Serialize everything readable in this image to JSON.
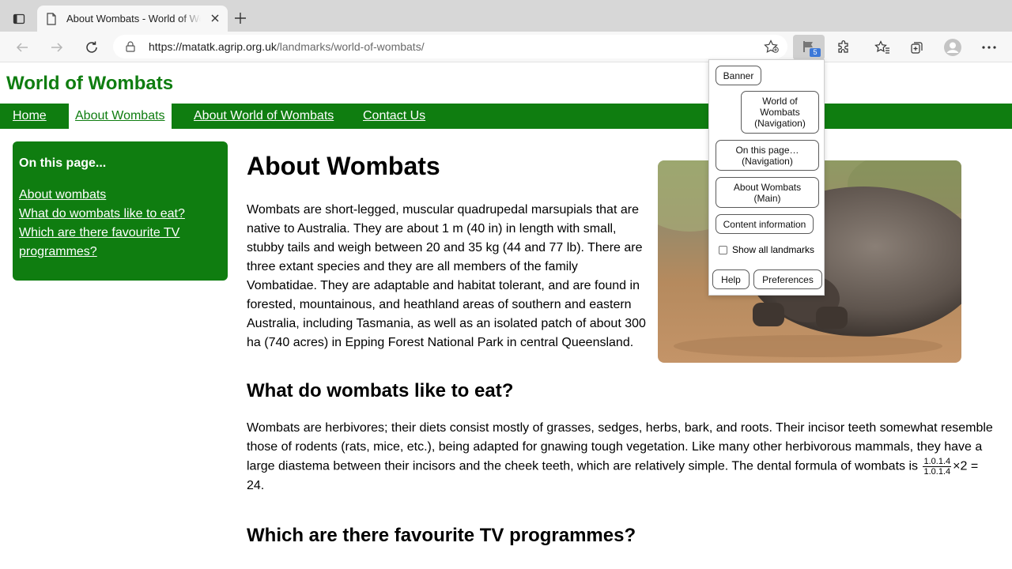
{
  "browser": {
    "tab_title": "About Wombats - World of Wombats",
    "url_host": "https://matatk.agrip.org.uk",
    "url_path": "/landmarks/world-of-wombats/",
    "extension_badge": "5"
  },
  "site": {
    "title": "World of Wombats",
    "nav": [
      "Home",
      "About Wombats",
      "About World of Wombats",
      "Contact Us"
    ],
    "brand_color": "#0f7d10"
  },
  "sidebar": {
    "title": "On this page...",
    "links": [
      "About wombats",
      "What do wombats like to eat?",
      "Which are there favourite TV programmes?"
    ]
  },
  "main": {
    "heading": "About Wombats",
    "intro": "Wombats are short-legged, muscular quadrupedal marsupials that are native to Australia. They are about 1 m (40 in) in length with small, stubby tails and weigh between 20 and 35 kg (44 and 77 lb). There are three extant species and they are all members of the family Vombatidae. They are adaptable and habitat tolerant, and are found in forested, mountainous, and heathland areas of southern and eastern Australia, including Tasmania, as well as an isolated patch of about 300 ha (740 acres) in Epping Forest National Park in central Queensland.",
    "eat_heading": "What do wombats like to eat?",
    "eat_text": "Wombats are herbivores; their diets consist mostly of grasses, sedges, herbs, bark, and roots. Their incisor teeth somewhat resemble those of rodents (rats, mice, etc.), being adapted for gnawing tough vegetation. Like many other herbivorous mammals, they have a large diastema between their incisors and the cheek teeth, which are relatively simple. The dental formula of wombats is",
    "formula_num": "1.0.1.4",
    "formula_den": "1.0.1.4",
    "formula_rest": "×2 =",
    "formula_result": "24.",
    "tv_heading": "Which are there favourite TV programmes?"
  },
  "popup": {
    "landmarks": [
      "Banner",
      "World of Wombats (Navigation)",
      "On this page… (Navigation)",
      "About Wombats (Main)",
      "Content information"
    ],
    "show_all_label": "Show all landmarks",
    "help": "Help",
    "preferences": "Preferences"
  }
}
